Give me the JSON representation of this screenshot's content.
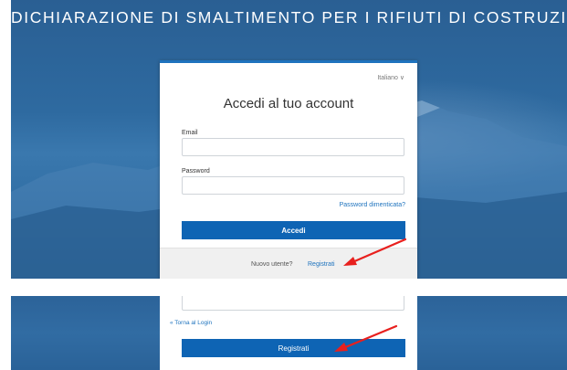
{
  "banner": {
    "title": "DICHIARAZIONE DI SMALTIMENTO PER I RIFIUTI DI COSTRUZIONI"
  },
  "login_card": {
    "language": "Italiano ∨",
    "title": "Accedi al tuo account",
    "email_label": "Email",
    "email_value": "",
    "password_label": "Password",
    "password_value": "",
    "forgot_password": "Password dimenticata?",
    "login_button": "Accedi",
    "footer": {
      "new_user_text": "Nuovo utente?",
      "register_link": "Registrati"
    }
  },
  "register_form": {
    "back_to_login": "« Torna al Login",
    "register_button": "Registrati"
  },
  "colors": {
    "accent": "#0e64b4",
    "link": "#1e73be",
    "arrow": "#e8201e",
    "background": "#2e6aa0"
  },
  "icons": {
    "annotation_arrow": "red-arrow-icon"
  }
}
